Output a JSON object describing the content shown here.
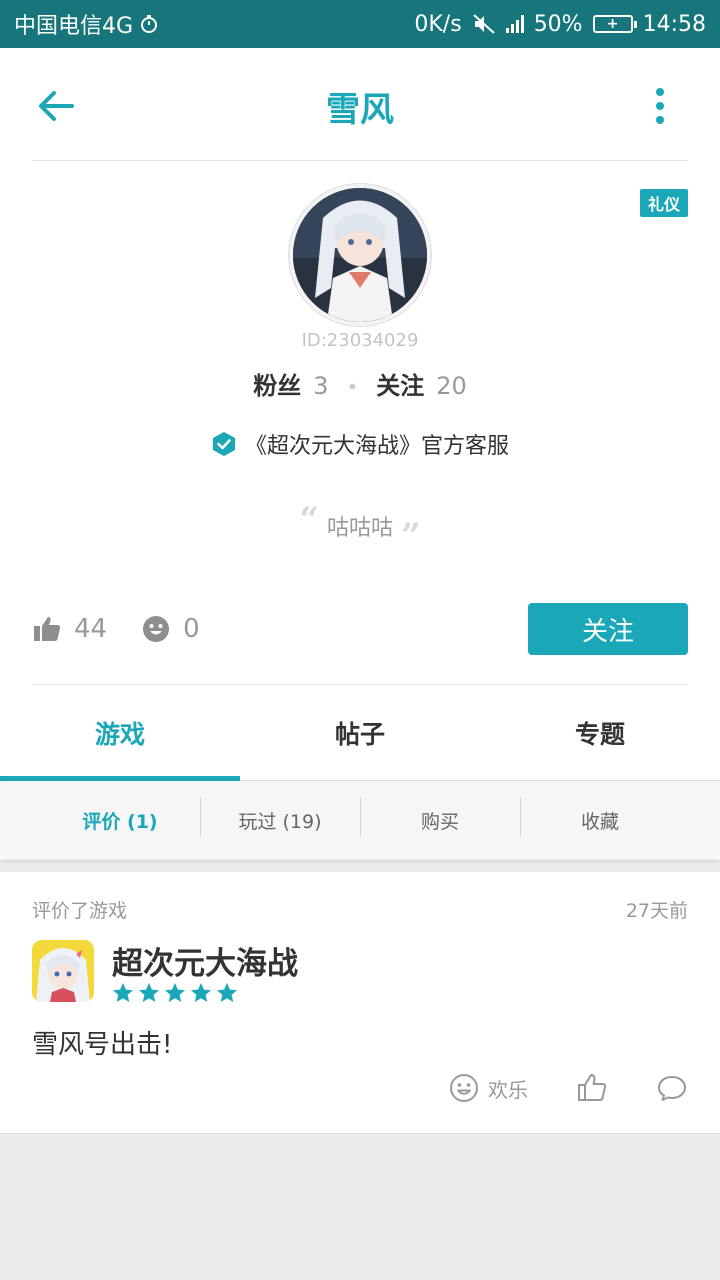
{
  "status_bar": {
    "carrier": "中国电信4G",
    "speed": "0K/s",
    "network": "4G",
    "battery": "50%",
    "time": "14:58"
  },
  "header": {
    "title": "雪风"
  },
  "profile": {
    "badge": "礼仪",
    "user_id": "ID:23034029",
    "fans_label": "粉丝",
    "fans_count": "3",
    "following_label": "关注",
    "following_count": "20",
    "verified_text": "《超次元大海战》官方客服",
    "signature": "咕咕咕",
    "likes": "44",
    "smiles": "0",
    "follow_button": "关注"
  },
  "tabs": [
    {
      "label": "游戏",
      "active": true
    },
    {
      "label": "帖子",
      "active": false
    },
    {
      "label": "专题",
      "active": false
    }
  ],
  "subtabs": [
    {
      "label": "评价 (1)",
      "active": true
    },
    {
      "label": "玩过 (19)",
      "active": false
    },
    {
      "label": "购买",
      "active": false
    },
    {
      "label": "收藏",
      "active": false
    }
  ],
  "review": {
    "type": "评价了游戏",
    "time": "27天前",
    "game_name": "超次元大海战",
    "rating": 5,
    "text": "雪风号出击!",
    "happy_label": "欢乐"
  },
  "colors": {
    "accent": "#1aa7b8",
    "status_bar": "#17767b"
  }
}
